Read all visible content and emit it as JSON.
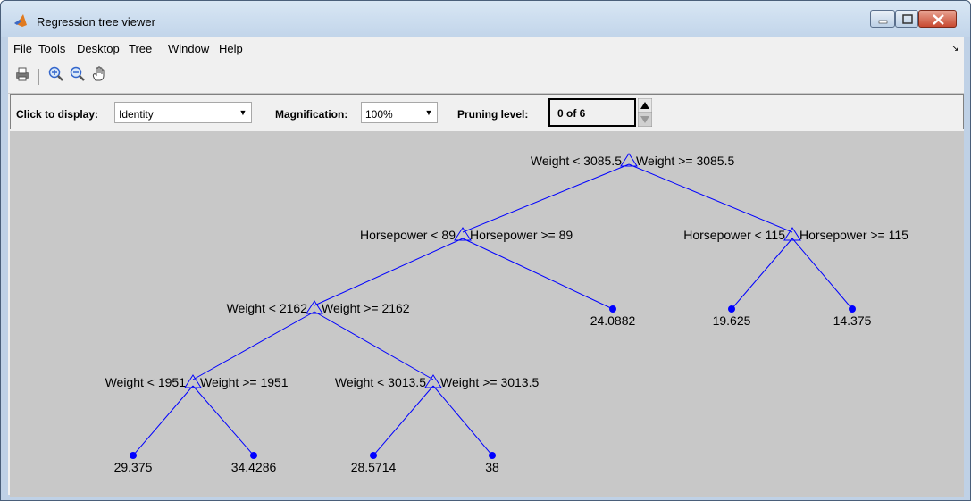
{
  "window": {
    "title": "Regression tree viewer"
  },
  "menu": {
    "items": [
      {
        "label": "File"
      },
      {
        "label": "Tools"
      },
      {
        "label": "Desktop"
      },
      {
        "label": "Tree"
      },
      {
        "label": "Window"
      },
      {
        "label": "Help"
      }
    ]
  },
  "toolbar": {
    "icons": [
      "print-icon",
      "zoom-in-icon",
      "zoom-out-icon",
      "pan-hand-icon"
    ]
  },
  "controls": {
    "display_label": "Click to display:",
    "display_value": "Identity",
    "magnification_label": "Magnification:",
    "magnification_value": "100%",
    "pruning_label": "Pruning level:",
    "pruning_value": "0 of 6"
  },
  "tree": {
    "nodes": [
      {
        "id": "n1",
        "type": "branch",
        "left": "Weight < 3085.5",
        "right": "Weight >= 3085.5"
      },
      {
        "id": "n2",
        "type": "branch",
        "left": "Horsepower < 89",
        "right": "Horsepower >= 89"
      },
      {
        "id": "n3",
        "type": "branch",
        "left": "Horsepower < 115",
        "right": "Horsepower >= 115"
      },
      {
        "id": "n4",
        "type": "branch",
        "left": "Weight < 2162",
        "right": "Weight >= 2162"
      },
      {
        "id": "n5",
        "type": "leaf",
        "value": "24.0882"
      },
      {
        "id": "n6",
        "type": "leaf",
        "value": "19.625"
      },
      {
        "id": "n7",
        "type": "leaf",
        "value": "14.375"
      },
      {
        "id": "n8",
        "type": "branch",
        "left": "Weight < 1951",
        "right": "Weight >= 1951"
      },
      {
        "id": "n9",
        "type": "branch",
        "left": "Weight < 3013.5",
        "right": "Weight >= 3013.5"
      },
      {
        "id": "n10",
        "type": "leaf",
        "value": "29.375"
      },
      {
        "id": "n11",
        "type": "leaf",
        "value": "34.4286"
      },
      {
        "id": "n12",
        "type": "leaf",
        "value": "28.5714"
      },
      {
        "id": "n13",
        "type": "leaf",
        "value": "38"
      }
    ],
    "colors": {
      "edge": "#0000ff",
      "background": "#c8c8c8"
    }
  }
}
